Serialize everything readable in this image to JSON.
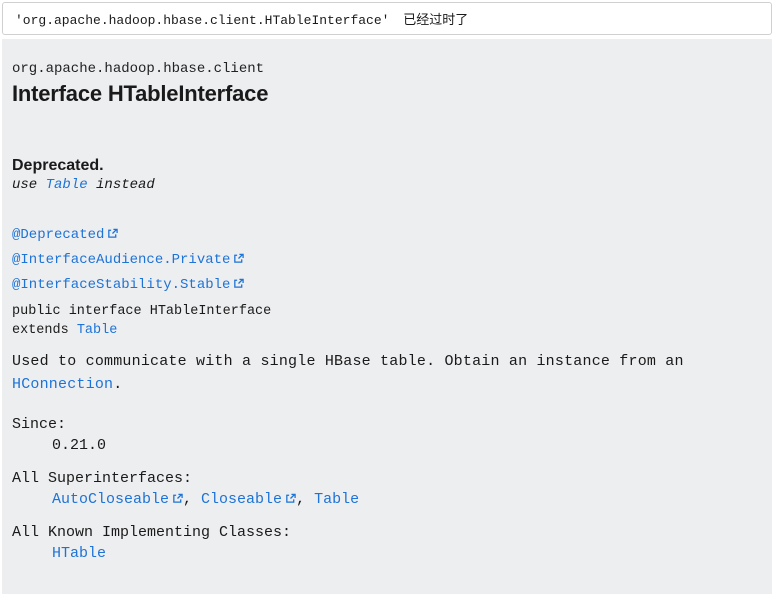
{
  "quote": {
    "path": "'org.apache.hadoop.hbase.client.HTableInterface'",
    "note": "已经过时了"
  },
  "pkg": "org.apache.hadoop.hbase.client",
  "title_prefix": "Interface ",
  "title_name": "HTableInterface",
  "deprecated": {
    "label": "Deprecated.",
    "use_word": "use ",
    "link": "Table",
    "instead": " instead"
  },
  "annotations": [
    {
      "text": "@Deprecated",
      "external": true
    },
    {
      "text": "@InterfaceAudience.Private",
      "external": true
    },
    {
      "text": "@InterfaceStability.Stable",
      "external": true
    }
  ],
  "signature": {
    "line1": "public interface HTableInterface",
    "extends_kw": "extends ",
    "extends_link": "Table"
  },
  "description": {
    "text1": "Used to communicate with a single HBase table. Obtain an instance from an ",
    "link": "HConnection",
    "text2": "."
  },
  "since": {
    "label": "Since:",
    "value": "0.21.0"
  },
  "superinterfaces": {
    "label": "All Superinterfaces:",
    "items": [
      {
        "text": "AutoCloseable",
        "external": true
      },
      {
        "text": "Closeable",
        "external": true
      },
      {
        "text": "Table",
        "external": false
      }
    ]
  },
  "implementing": {
    "label": "All Known Implementing Classes:",
    "items": [
      {
        "text": "HTable",
        "external": false
      }
    ]
  }
}
